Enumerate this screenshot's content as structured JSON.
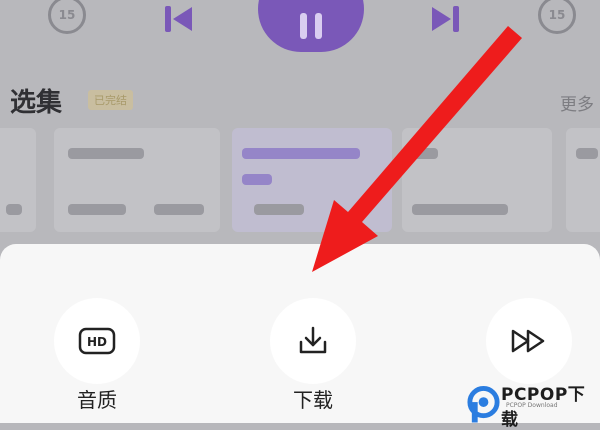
{
  "player": {
    "rewind_label": "15",
    "forward_label": "15"
  },
  "episodes": {
    "title": "选集",
    "badge": "已完结",
    "more": "更多"
  },
  "sheet": {
    "items": [
      {
        "label": "音质",
        "icon": "hd-icon"
      },
      {
        "label": "下载",
        "icon": "download-icon"
      },
      {
        "label": "",
        "icon": "fast-forward-icon"
      }
    ],
    "hd_icon_text": "HD"
  },
  "watermark": {
    "brand": "PCPOP下载",
    "sub": "PCPOP Download"
  },
  "colors": {
    "accent": "#7a58b8",
    "arrow": "#ee1c1c",
    "sheet": "#f7f7f7"
  }
}
